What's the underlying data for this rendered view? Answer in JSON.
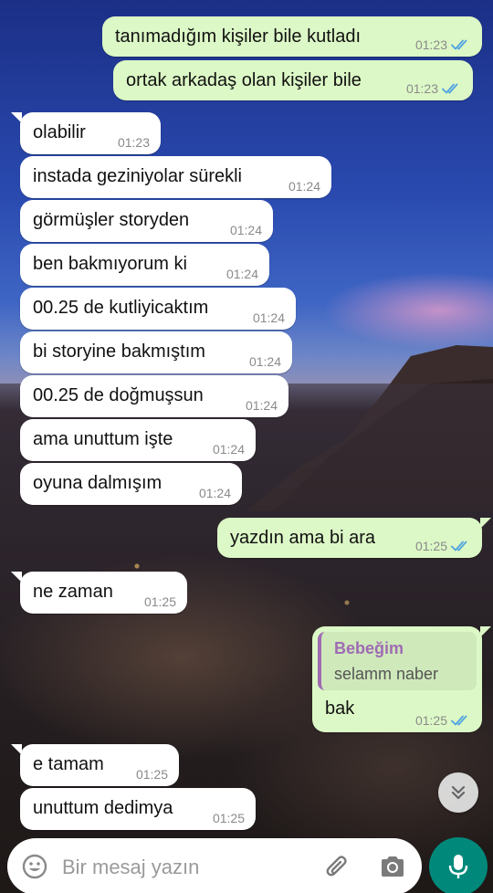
{
  "messages": [
    {
      "dir": "out",
      "text": "tanımadığım kişiler bile kutladı",
      "time": "01:23",
      "read": true
    },
    {
      "dir": "out",
      "text": "ortak arkadaş olan kişiler bile",
      "time": "01:23",
      "read": true
    },
    {
      "dir": "in",
      "text": "olabilir",
      "time": "01:23"
    },
    {
      "dir": "in",
      "text": "instada geziniyolar sürekli",
      "time": "01:24"
    },
    {
      "dir": "in",
      "text": "görmüşler storyden",
      "time": "01:24"
    },
    {
      "dir": "in",
      "text": "ben bakmıyorum ki",
      "time": "01:24"
    },
    {
      "dir": "in",
      "text": "00.25 de kutliyicaktım",
      "time": "01:24"
    },
    {
      "dir": "in",
      "text": "bi storyine bakmıştım",
      "time": "01:24"
    },
    {
      "dir": "in",
      "text": "00.25 de doğmuşsun",
      "time": "01:24"
    },
    {
      "dir": "in",
      "text": "ama unuttum işte",
      "time": "01:24"
    },
    {
      "dir": "in",
      "text": "oyuna dalmışım",
      "time": "01:24"
    },
    {
      "dir": "out",
      "text": "yazdın ama bi ara",
      "time": "01:25",
      "read": true
    },
    {
      "dir": "in",
      "text": "ne zaman",
      "time": "01:25"
    },
    {
      "dir": "out",
      "text": "bak",
      "time": "01:25",
      "read": true,
      "quote": {
        "name": "Bebeğim",
        "text": "selamm naber"
      }
    },
    {
      "dir": "in",
      "text": "e tamam",
      "time": "01:25"
    },
    {
      "dir": "in",
      "text": "unuttum dedimya",
      "time": "01:25"
    }
  ],
  "composer": {
    "placeholder": "Bir mesaj yazın"
  },
  "icons": {
    "emoji": "emoji-icon",
    "attach": "paperclip-icon",
    "camera": "camera-icon",
    "mic": "microphone-icon",
    "scroll": "double-chevron-down-icon",
    "read": "double-check-icon"
  },
  "colors": {
    "outgoing_bubble": "#dcf8c6",
    "incoming_bubble": "#ffffff",
    "read_ticks": "#4fa3e0",
    "mic_button": "#00897b",
    "quote_accent": "#9f6bb3"
  }
}
